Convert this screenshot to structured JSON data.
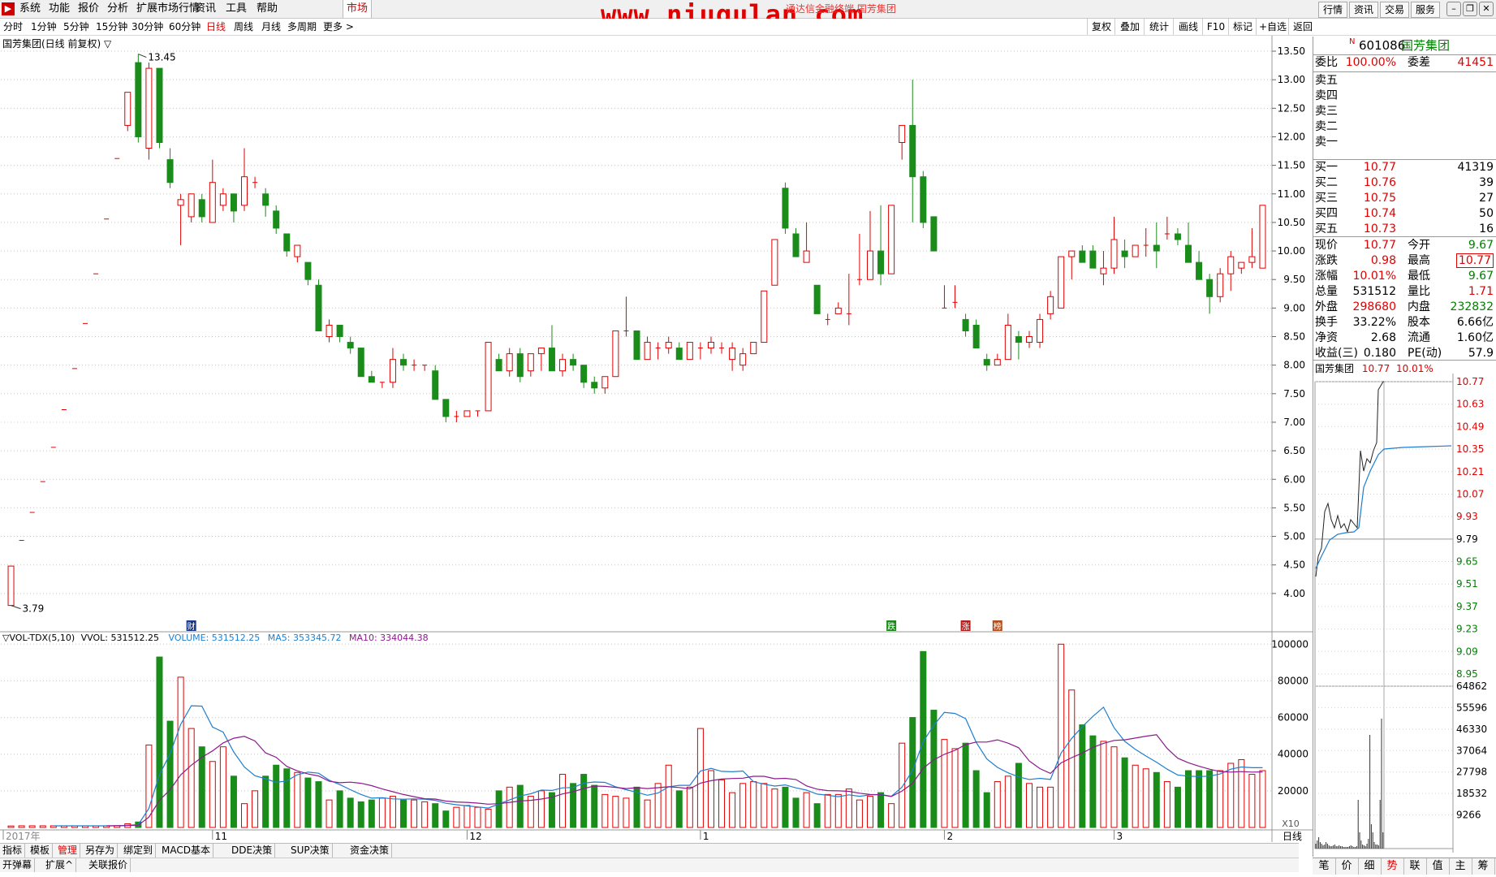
{
  "menu": {
    "items": [
      "系统",
      "功能",
      "报价",
      "分析",
      "扩展市场行情",
      "资讯",
      "工具",
      "帮助"
    ],
    "active": "市场",
    "banner": "www.niugulan.com",
    "banner_sub": "通达信金融终端 国芳集团",
    "right_buttons": [
      "行情",
      "资讯",
      "交易",
      "服务"
    ]
  },
  "periods": {
    "items": [
      "分时",
      "1分钟",
      "5分钟",
      "15分钟",
      "30分钟",
      "60分钟",
      "日线",
      "周线",
      "月线",
      "多周期",
      "更多"
    ],
    "active": "日线",
    "tools": [
      "复权",
      "叠加",
      "统计",
      "画线",
      "F10",
      "标记",
      "+自选",
      "返回"
    ]
  },
  "chart_title": "国芳集团(日线 前复权) ▽",
  "chart_data": [
    {
      "type": "candlestick",
      "title": "国芳集团(日线 前复权)",
      "ylim": [
        3.5,
        13.6
      ],
      "yticks": [
        "13.50",
        "13.00",
        "12.50",
        "12.00",
        "11.50",
        "11.00",
        "10.50",
        "10.00",
        "9.50",
        "9.00",
        "8.50",
        "8.00",
        "7.50",
        "7.00",
        "6.50",
        "6.00",
        "5.50",
        "5.00",
        "4.50",
        "4.00"
      ],
      "x_labels": [
        "2017年",
        "11",
        "12",
        "1",
        "2",
        "3"
      ],
      "annotations": {
        "high": "13.45",
        "low": "3.79"
      },
      "ohlc": [
        [
          3.79,
          4.48,
          3.79,
          4.48
        ],
        [
          4.93,
          4.93,
          4.93,
          4.93
        ],
        [
          5.42,
          5.42,
          5.42,
          5.42
        ],
        [
          5.96,
          5.96,
          5.96,
          5.96
        ],
        [
          6.56,
          6.56,
          6.56,
          6.56
        ],
        [
          7.22,
          7.22,
          7.22,
          7.22
        ],
        [
          7.94,
          7.94,
          7.94,
          7.94
        ],
        [
          8.73,
          8.73,
          8.73,
          8.73
        ],
        [
          9.6,
          9.6,
          9.6,
          9.6
        ],
        [
          10.56,
          10.56,
          10.56,
          10.56
        ],
        [
          11.62,
          11.62,
          11.62,
          11.62
        ],
        [
          12.2,
          12.78,
          12.1,
          12.78
        ],
        [
          13.3,
          13.45,
          11.9,
          12.0
        ],
        [
          11.8,
          13.3,
          11.6,
          13.2
        ],
        [
          13.2,
          13.2,
          11.8,
          11.9
        ],
        [
          11.6,
          11.8,
          11.1,
          11.2
        ],
        [
          10.8,
          11.0,
          10.1,
          10.9
        ],
        [
          10.6,
          11.0,
          10.5,
          11.0
        ],
        [
          10.9,
          11.0,
          10.5,
          10.6
        ],
        [
          10.5,
          11.6,
          10.5,
          11.2
        ],
        [
          10.8,
          11.1,
          10.7,
          11.0
        ],
        [
          11.0,
          11.0,
          10.5,
          10.7
        ],
        [
          10.8,
          11.8,
          10.7,
          11.3
        ],
        [
          11.2,
          11.3,
          11.1,
          11.2
        ],
        [
          11.0,
          11.1,
          10.6,
          10.8
        ],
        [
          10.7,
          10.8,
          10.3,
          10.4
        ],
        [
          10.3,
          10.3,
          9.9,
          10.0
        ],
        [
          9.9,
          10.1,
          9.8,
          10.1
        ],
        [
          9.8,
          9.8,
          9.4,
          9.5
        ],
        [
          9.4,
          9.5,
          8.6,
          8.6
        ],
        [
          8.5,
          8.8,
          8.4,
          8.7
        ],
        [
          8.7,
          8.7,
          8.4,
          8.5
        ],
        [
          8.4,
          8.5,
          8.2,
          8.3
        ],
        [
          8.3,
          8.3,
          7.8,
          7.8
        ],
        [
          7.8,
          7.9,
          7.7,
          7.7
        ],
        [
          7.7,
          7.7,
          7.6,
          7.7
        ],
        [
          7.7,
          8.3,
          7.6,
          8.1
        ],
        [
          8.1,
          8.2,
          7.9,
          8.0
        ],
        [
          8.0,
          8.1,
          7.9,
          8.0
        ],
        [
          8.0,
          8.0,
          7.9,
          8.0
        ],
        [
          7.9,
          8.0,
          7.4,
          7.4
        ],
        [
          7.4,
          7.4,
          7.0,
          7.1
        ],
        [
          7.1,
          7.2,
          7.0,
          7.1
        ],
        [
          7.1,
          7.2,
          7.1,
          7.2
        ],
        [
          7.2,
          7.2,
          7.1,
          7.2
        ],
        [
          7.2,
          8.4,
          7.2,
          8.4
        ],
        [
          8.1,
          8.2,
          7.9,
          7.9
        ],
        [
          7.9,
          8.3,
          7.8,
          8.2
        ],
        [
          8.2,
          8.3,
          7.7,
          7.8
        ],
        [
          7.9,
          8.2,
          7.8,
          8.2
        ],
        [
          8.2,
          8.2,
          7.9,
          8.3
        ],
        [
          8.3,
          8.7,
          7.9,
          7.9
        ],
        [
          7.9,
          8.2,
          7.8,
          8.1
        ],
        [
          8.1,
          8.2,
          7.9,
          8.0
        ],
        [
          8.0,
          8.0,
          7.6,
          7.7
        ],
        [
          7.7,
          7.8,
          7.5,
          7.6
        ],
        [
          7.6,
          7.8,
          7.5,
          7.8
        ],
        [
          7.8,
          8.6,
          7.8,
          8.6
        ],
        [
          8.6,
          9.2,
          8.5,
          8.6
        ],
        [
          8.6,
          8.6,
          8.1,
          8.1
        ],
        [
          8.1,
          8.5,
          8.1,
          8.4
        ],
        [
          8.3,
          8.4,
          8.1,
          8.3
        ],
        [
          8.3,
          8.5,
          8.2,
          8.4
        ],
        [
          8.3,
          8.4,
          8.1,
          8.1
        ],
        [
          8.1,
          8.4,
          8.1,
          8.4
        ],
        [
          8.3,
          8.4,
          8.1,
          8.3
        ],
        [
          8.3,
          8.5,
          8.2,
          8.4
        ],
        [
          8.3,
          8.4,
          8.2,
          8.3
        ],
        [
          8.1,
          8.4,
          7.9,
          8.3
        ],
        [
          8.0,
          8.3,
          7.9,
          8.2
        ],
        [
          8.2,
          8.4,
          8.2,
          8.4
        ],
        [
          8.4,
          9.3,
          8.4,
          9.3
        ],
        [
          9.4,
          10.2,
          9.4,
          10.2
        ],
        [
          11.1,
          11.2,
          10.3,
          10.4
        ],
        [
          10.3,
          10.4,
          9.9,
          9.9
        ],
        [
          9.8,
          10.5,
          9.8,
          10.0
        ],
        [
          9.4,
          9.4,
          8.9,
          8.9
        ],
        [
          8.8,
          8.9,
          8.7,
          8.8
        ],
        [
          8.9,
          9.1,
          8.9,
          9.0
        ],
        [
          8.9,
          9.6,
          8.7,
          8.9
        ],
        [
          9.5,
          10.3,
          9.4,
          9.5
        ],
        [
          9.5,
          10.7,
          9.5,
          10.0
        ],
        [
          10.0,
          10.8,
          9.4,
          9.6
        ],
        [
          9.6,
          10.8,
          9.6,
          10.8
        ],
        [
          11.9,
          12.1,
          11.6,
          12.2
        ],
        [
          12.2,
          13.0,
          10.5,
          11.3
        ],
        [
          11.3,
          11.4,
          10.4,
          10.5
        ],
        [
          10.6,
          10.6,
          10.0,
          10.0
        ],
        [
          9.0,
          9.4,
          9.0,
          9.0
        ],
        [
          9.1,
          9.4,
          9.0,
          9.1
        ],
        [
          8.8,
          8.9,
          8.5,
          8.6
        ],
        [
          8.7,
          8.8,
          8.3,
          8.3
        ],
        [
          8.1,
          8.2,
          7.9,
          8.0
        ],
        [
          8.0,
          8.2,
          8.0,
          8.1
        ],
        [
          8.1,
          8.9,
          8.1,
          8.7
        ],
        [
          8.5,
          8.6,
          8.1,
          8.4
        ],
        [
          8.4,
          8.6,
          8.3,
          8.5
        ],
        [
          8.4,
          8.9,
          8.3,
          8.8
        ],
        [
          8.9,
          9.3,
          8.8,
          9.2
        ],
        [
          9.0,
          9.8,
          9.0,
          9.9
        ],
        [
          9.9,
          10.0,
          9.5,
          10.0
        ],
        [
          10.0,
          10.1,
          9.8,
          9.8
        ],
        [
          10.0,
          10.1,
          9.8,
          9.7
        ],
        [
          9.6,
          10.0,
          9.4,
          9.7
        ],
        [
          9.7,
          10.6,
          9.6,
          10.2
        ],
        [
          10.0,
          10.2,
          9.7,
          9.9
        ],
        [
          9.9,
          10.1,
          9.9,
          10.1
        ],
        [
          10.1,
          10.4,
          9.9,
          10.1
        ],
        [
          10.1,
          10.5,
          9.7,
          10.0
        ],
        [
          10.3,
          10.6,
          10.2,
          10.3
        ],
        [
          10.3,
          10.4,
          10.1,
          10.2
        ],
        [
          10.1,
          10.5,
          9.9,
          9.8
        ],
        [
          9.8,
          10.0,
          9.5,
          9.5
        ],
        [
          9.5,
          9.6,
          8.9,
          9.2
        ],
        [
          9.2,
          9.7,
          9.1,
          9.6
        ],
        [
          9.6,
          10.0,
          9.3,
          9.9
        ],
        [
          9.7,
          9.8,
          9.6,
          9.8
        ],
        [
          9.8,
          10.4,
          9.7,
          9.9
        ],
        [
          9.7,
          10.8,
          9.7,
          10.8
        ]
      ],
      "markers": [
        {
          "label": "财",
          "index": 17
        },
        {
          "label": "跌",
          "index": 83
        },
        {
          "label": "涨",
          "index": 90
        },
        {
          "label": "榜",
          "index": 93
        }
      ]
    },
    {
      "type": "bar",
      "title": "VOL-TDX(5,10)",
      "ylim": [
        0,
        105000
      ],
      "yticks": [
        "100000",
        "80000",
        "60000",
        "40000",
        "20000"
      ],
      "scale_label": "X10",
      "volumes": [
        800,
        900,
        900,
        900,
        900,
        900,
        900,
        900,
        900,
        900,
        1000,
        2000,
        3000,
        45000,
        93000,
        58000,
        82000,
        54000,
        44000,
        36000,
        44000,
        28000,
        13000,
        20000,
        28000,
        34000,
        32000,
        30000,
        27000,
        25000,
        15000,
        20000,
        16000,
        14000,
        15000,
        16000,
        17000,
        15000,
        15000,
        14000,
        13000,
        9000,
        11000,
        12000,
        11000,
        10000,
        20000,
        22000,
        23000,
        17000,
        20000,
        19000,
        29000,
        24000,
        29000,
        23000,
        18000,
        17000,
        16000,
        22000,
        15000,
        24000,
        34000,
        20000,
        22000,
        54000,
        31000,
        26000,
        19000,
        24000,
        25000,
        24000,
        21000,
        22000,
        16000,
        19000,
        13000,
        18000,
        18000,
        21000,
        15000,
        17000,
        19000,
        13000,
        46000,
        60000,
        96000,
        64000,
        48000,
        43000,
        46000,
        31000,
        19000,
        25000,
        28000,
        35000,
        24000,
        22000,
        22000,
        100000,
        75000,
        56000,
        50000,
        47000,
        44000,
        38000,
        34000,
        32000,
        30000,
        25000,
        22000,
        31000,
        31000,
        31000,
        31000,
        35000,
        37000,
        29000,
        31000,
        39000,
        33000,
        31000,
        25000,
        28000,
        31000,
        28000,
        29000,
        37000,
        53000
      ],
      "series": [
        {
          "name": "VOLUME",
          "value": "531512.25"
        },
        {
          "name": "MA5",
          "value": "353345.72"
        },
        {
          "name": "MA10",
          "value": "334044.38"
        }
      ],
      "vvol": "VVOL: 531512.25"
    }
  ],
  "vol_legend": {
    "prefix": "▽VOL-TDX(5,10)",
    "vvol": "VVOL: 531512.25",
    "volume": "VOLUME: 531512.25",
    "ma5": "MA5: 353345.72",
    "ma10": "MA10: 334044.38"
  },
  "date_bar": {
    "left_label": "2017年",
    "right_label": "日线"
  },
  "bottom_tabs": [
    "指标",
    "模板",
    "管理",
    "另存为",
    "绑定到",
    "MACD基本",
    "DDE决策",
    "SUP决策",
    "资金决策"
  ],
  "bottom_tabs_active": "管理",
  "bottom_tabs2": [
    "开弹幕",
    "扩展^",
    "关联报价"
  ],
  "stock": {
    "code": "601086",
    "name": "国芳集团",
    "flag": "N"
  },
  "order_book": {
    "weibi_label": "委比",
    "weibi": "100.00%",
    "weicha_label": "委差",
    "weicha": "41451",
    "sells": [
      "卖五",
      "卖四",
      "卖三",
      "卖二",
      "卖一"
    ],
    "buys": [
      {
        "label": "买一",
        "price": "10.77",
        "vol": "41319"
      },
      {
        "label": "买二",
        "price": "10.76",
        "vol": "39"
      },
      {
        "label": "买三",
        "price": "10.75",
        "vol": "27"
      },
      {
        "label": "买四",
        "price": "10.74",
        "vol": "50"
      },
      {
        "label": "买五",
        "price": "10.73",
        "vol": "16"
      }
    ]
  },
  "quote": [
    {
      "l": "现价",
      "v": "10.77",
      "vc": "red",
      "l2": "今开",
      "v2": "9.67",
      "v2c": "green"
    },
    {
      "l": "涨跌",
      "v": "0.98",
      "vc": "red",
      "l2": "最高",
      "v2": "10.77",
      "v2c": "red"
    },
    {
      "l": "涨幅",
      "v": "10.01%",
      "vc": "red",
      "l2": "最低",
      "v2": "9.67",
      "v2c": "green"
    },
    {
      "l": "总量",
      "v": "531512",
      "vc": "",
      "l2": "量比",
      "v2": "1.71",
      "v2c": "red"
    },
    {
      "l": "外盘",
      "v": "298680",
      "vc": "red",
      "l2": "内盘",
      "v2": "232832",
      "v2c": "green"
    },
    {
      "l": "换手",
      "v": "33.22%",
      "vc": "",
      "l2": "股本",
      "v2": "6.66亿",
      "v2c": ""
    },
    {
      "l": "净资",
      "v": "2.68",
      "vc": "",
      "l2": "流通",
      "v2": "1.60亿",
      "v2c": ""
    },
    {
      "l": "收益(三)",
      "v": "0.180",
      "vc": "",
      "l2": "PE(动)",
      "v2": "57.9",
      "v2c": ""
    }
  ],
  "mini_chart": {
    "name": "国芳集团",
    "price": "10.77",
    "pct": "10.01%",
    "yticks": [
      "10.77",
      "10.63",
      "10.49",
      "10.35",
      "10.21",
      "10.07",
      "9.93",
      "9.79",
      "9.65",
      "9.51",
      "9.37",
      "9.23",
      "9.09",
      "8.95"
    ],
    "vol_ticks": [
      "64862",
      "55596",
      "46330",
      "37064",
      "27798",
      "18532",
      "9266"
    ]
  },
  "right_tabs": [
    "笔",
    "价",
    "细",
    "势",
    "联",
    "值",
    "主",
    "筹"
  ],
  "right_tabs_active": "势",
  "colors": {
    "up": "#e00000",
    "down": "#1a8c1a",
    "ma5": "#1e7fd0",
    "ma10": "#8b1a8b",
    "grid": "#c8c8c8"
  }
}
